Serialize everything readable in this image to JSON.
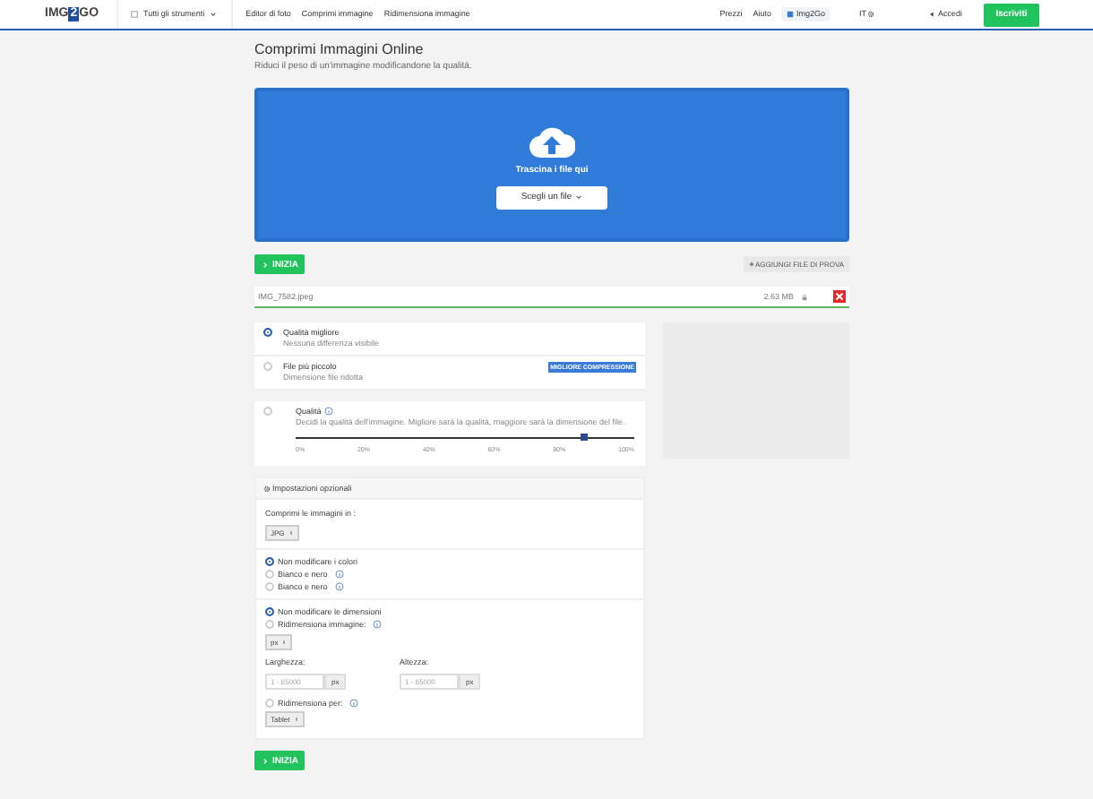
{
  "navbar": {
    "logo": [
      "IMG",
      "2",
      "GO"
    ],
    "tools_menu": "Tutti gli strumenti",
    "links": [
      "Editor di foto",
      "Comprimi immagine",
      "Ridimensiona immagine"
    ],
    "right_links": [
      "Prezzi",
      "Aiuto"
    ],
    "app_button": "Img2Go",
    "language": "IT",
    "login": "Accedi",
    "signup": "Iscriviti"
  },
  "title": "Comprimi Immagini Online",
  "subtitle": "Riduci il peso di un'immagine modificandone la qualità.",
  "dropzone": {
    "label": "Trascina i file qui",
    "button": "Scegli un file"
  },
  "start_button": "INIZIA",
  "sample_button": "AGGIUNGI FILE DI PROVA",
  "file": {
    "name": "IMG_7582.jpeg",
    "size": "2.63 MB"
  },
  "modes": [
    {
      "kind": "preset",
      "title": "Qualità migliore",
      "subtitle": "Nessuna differenza visibile",
      "selected": true
    },
    {
      "kind": "preset",
      "title": "File più piccolo",
      "subtitle": "Dimensione file ridotta",
      "badge": "MIGLIORE COMPRESSIONE",
      "selected": false
    },
    {
      "kind": "slider",
      "title": "Qualità",
      "subtitle": "Decidi la qualità dell'immagine. Migliore sarà la qualità, maggiore sarà la dimensione del file.",
      "level": 0.85,
      "ticks": [
        "0%",
        "20%",
        "40%",
        "60%",
        "80%",
        "100%"
      ],
      "selected": false
    }
  ],
  "optional": {
    "header": "Impostazioni opzionali",
    "format_label": "Comprimi le immagini in :",
    "format": "JPG",
    "colors": [
      {
        "label": "Non modificare i colori",
        "selected": true,
        "info": false
      },
      {
        "label": "Bianco e nero",
        "selected": false,
        "info": true
      },
      {
        "label": "Bianco e nero",
        "selected": false,
        "info": true
      }
    ],
    "sizes": [
      {
        "label": "Non modificare le dimensioni",
        "selected": true,
        "info": false
      },
      {
        "label": "Ridimensiona immagine:",
        "selected": false,
        "info": true
      }
    ],
    "unit": "px",
    "width_label": "Larghezza:",
    "width_placeholder": "1 - 65000",
    "width_unit": "px",
    "height_label": "Altezza:",
    "height_placeholder": "1 - 65000",
    "height_unit": "px",
    "resize_for": {
      "label": "Ridimensiona per:",
      "selected": false
    },
    "device": "Tablet"
  },
  "start_button_bottom": "INIZIA"
}
